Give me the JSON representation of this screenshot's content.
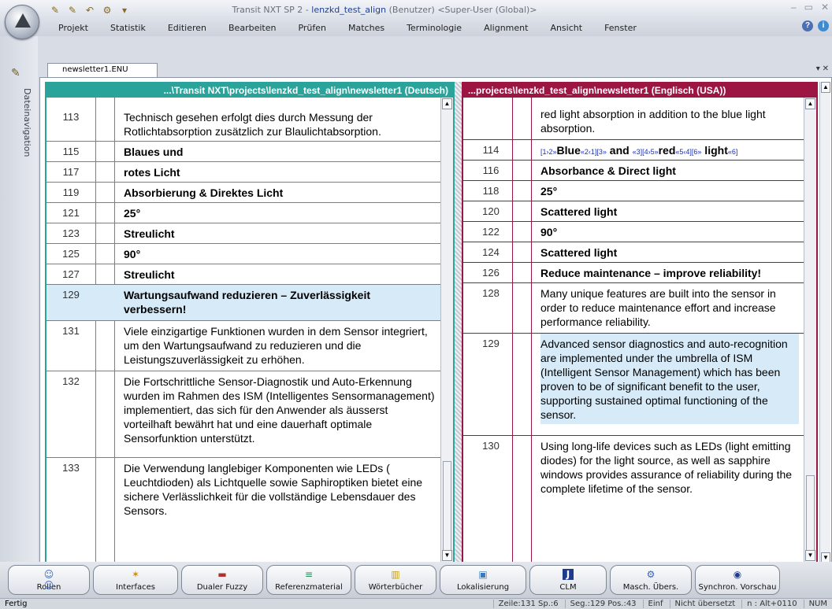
{
  "window": {
    "title_prefix": "Transit NXT SP 2 - ",
    "title_project": "lenzkd_test_align",
    "title_suffix": " (Benutzer) <Super-User (Global)>"
  },
  "menu": [
    "Projekt",
    "Statistik",
    "Editieren",
    "Bearbeiten",
    "Prüfen",
    "Matches",
    "Terminologie",
    "Alignment",
    "Ansicht",
    "Fenster"
  ],
  "sidebar": {
    "label": "Dateinavigation"
  },
  "doc_tab": {
    "label": "newsletter1.ENU"
  },
  "left_pane": {
    "header": "...\\Transit NXT\\projects\\lenzkd_test_align\\newsletter1 (Deutsch)",
    "rows": [
      {
        "num": "113",
        "text": "Technisch gesehen erfolgt dies durch Messung der Rotlichtabsorption zusätzlich zur Blaulichtabsorption."
      },
      {
        "num": "115",
        "text": "Blaues und"
      },
      {
        "num": "117",
        "text": "rotes Licht"
      },
      {
        "num": "119",
        "text": "Absorbierung & Direktes Licht"
      },
      {
        "num": "121",
        "text": "25°"
      },
      {
        "num": "123",
        "text": "Streulicht"
      },
      {
        "num": "125",
        "text": "90°"
      },
      {
        "num": "127",
        "text": "Streulicht"
      },
      {
        "num": "129",
        "text": "Wartungsaufwand reduzieren – Zuverlässigkeit verbessern!"
      },
      {
        "num": "131",
        "text": "Viele einzigartige Funktionen wurden in dem Sensor integriert, um den Wartungsaufwand zu reduzieren und die Leistungszuverlässigkeit zu erhöhen."
      },
      {
        "num": "132",
        "text": "Die Fortschrittliche Sensor-Diagnostik und Auto-Erkennung wurden im Rahmen des ISM (Intelligentes Sensormanagement) implementiert, das sich für den Anwender als äusserst vorteilhaft bewährt hat und eine dauerhaft optimale Sensorfunktion unterstützt."
      },
      {
        "num": "133",
        "text": "Die Verwendung langlebiger Komponenten wie LEDs ( Leuchtdioden) als Lichtquelle sowie Saphiroptiken bietet eine sichere Verlässlichkeit für die vollständige Lebensdauer des Sensors."
      }
    ]
  },
  "right_pane": {
    "header": "...projects\\lenzkd_test_align\\newsletter1 (Englisch (USA))",
    "rows": [
      {
        "num": "",
        "text": "red light absorption in addition to the blue light absorption."
      },
      {
        "num": "114",
        "tag1": "[1›2»",
        "w1": "Blue",
        "tag2": "«2‹1][3»",
        "w2": " and ",
        "tag3": "«3][4›5»",
        "w3": "red",
        "tag4": "«5‹4][6»",
        "w4": " light",
        "tag5": "«6]"
      },
      {
        "num": "116",
        "text": "Absorbance & Direct light"
      },
      {
        "num": "118",
        "text": "25°"
      },
      {
        "num": "120",
        "text": "Scattered light"
      },
      {
        "num": "122",
        "text": "90°"
      },
      {
        "num": "124",
        "text": "Scattered light"
      },
      {
        "num": "126",
        "text": "Reduce maintenance – improve reliability!"
      },
      {
        "num": "128",
        "text": "Many unique features are built into the sensor in order to reduce maintenance effort and increase performance reliability."
      },
      {
        "num": "129",
        "text": "Advanced sensor diagnostics and auto-recognition are implemented under the umbrella of ISM (Intelligent Sensor Management) which has been proven to be of significant benefit to the user, supporting sustained optimal functioning of the sensor."
      },
      {
        "num": "130",
        "text": "Using long-life devices such as LEDs (light emitting diodes) for the light source, as well as sapphire windows provides assurance of reliability during the complete lifetime of the sensor."
      }
    ]
  },
  "toolbar": [
    "Rollen",
    "Interfaces",
    "Dualer Fuzzy",
    "Referenzmaterial",
    "Wörterbücher",
    "Lokalisierung",
    "CLM",
    "Masch. Übers.",
    "Synchron. Vorschau"
  ],
  "status": {
    "ready": "Fertig",
    "zeile": "Zeile:131 Sp.:6",
    "seg": "Seg.:129 Pos.:43",
    "mode": "Einf",
    "trans": "Nicht übersetzt",
    "char": "n : Alt+0110",
    "num": "NUM"
  },
  "colors": {
    "source_accent": "#2aa39b",
    "target_accent": "#9d1543",
    "highlight": "#d6eaf8"
  }
}
